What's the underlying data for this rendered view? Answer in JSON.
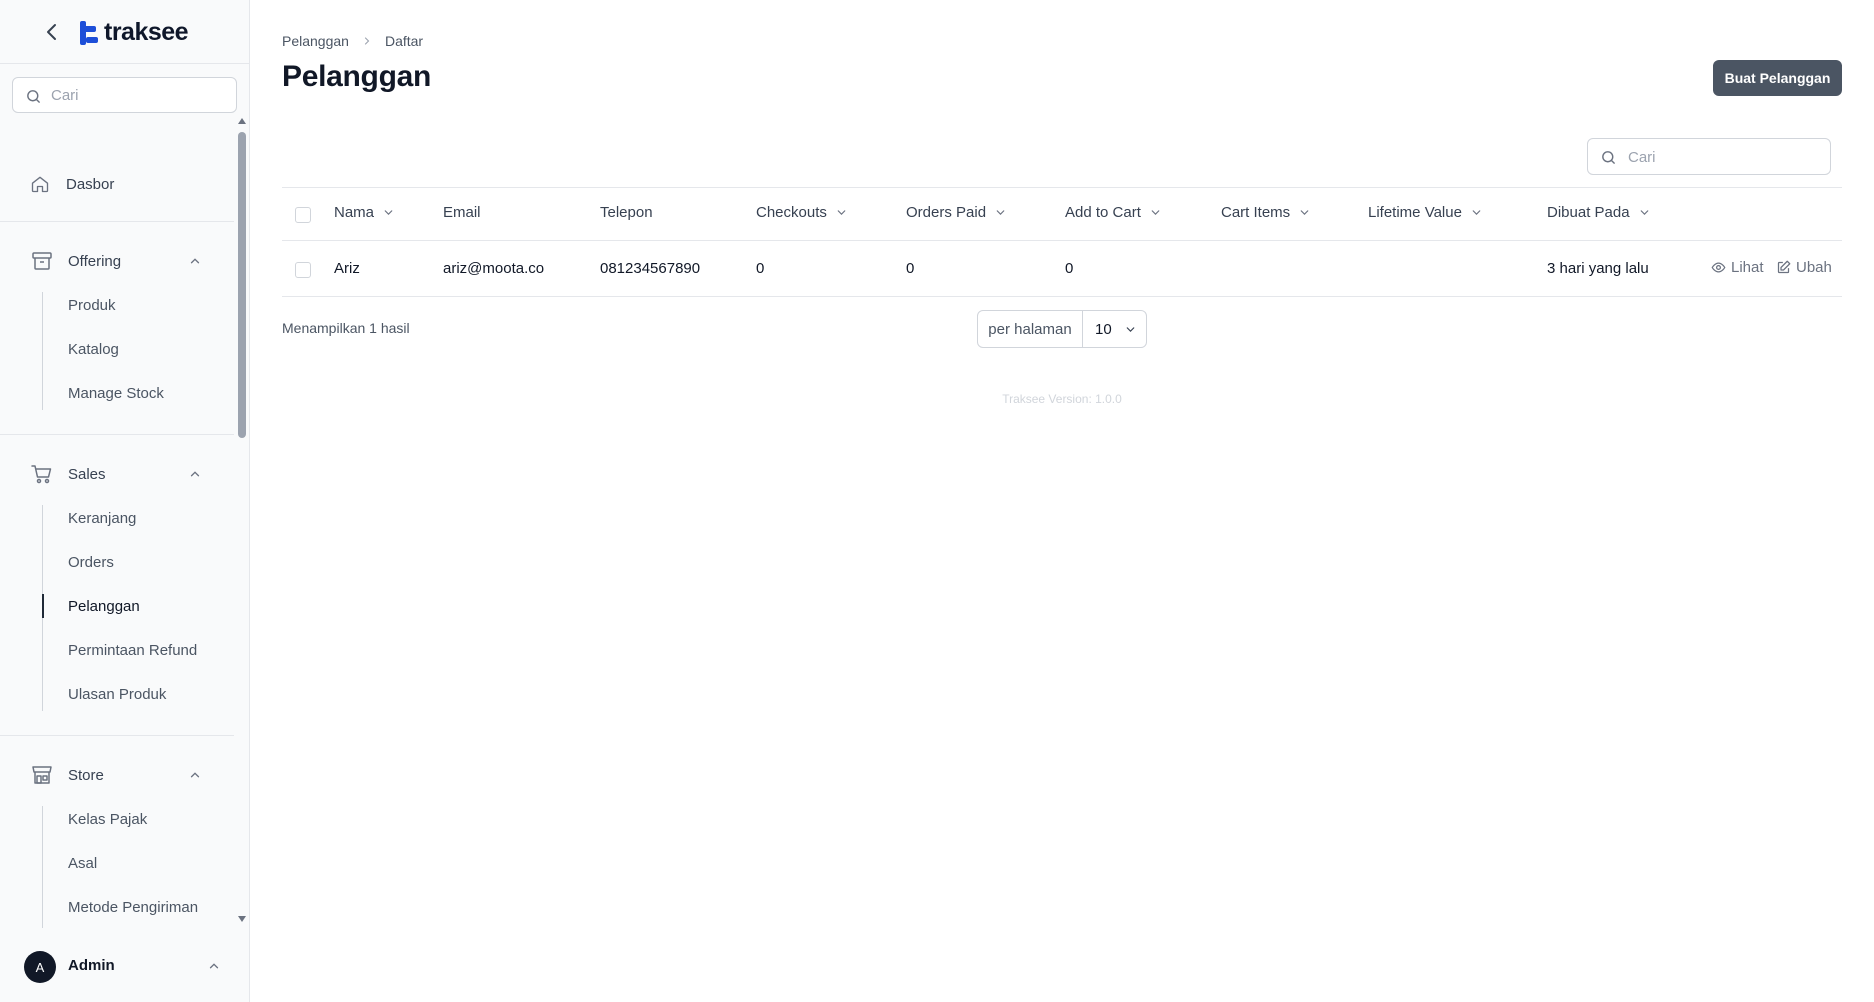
{
  "brand": {
    "name": "traksee",
    "color": "#1d4ed8"
  },
  "sidebar": {
    "search_placeholder": "Cari",
    "dashboard_label": "Dasbor",
    "groups": [
      {
        "label": "Offering",
        "icon": "box-icon",
        "items": [
          "Produk",
          "Katalog",
          "Manage Stock"
        ]
      },
      {
        "label": "Sales",
        "icon": "cart-icon",
        "items": [
          "Keranjang",
          "Orders",
          "Pelanggan",
          "Permintaan Refund",
          "Ulasan Produk"
        ]
      },
      {
        "label": "Store",
        "icon": "store-icon",
        "items": [
          "Kelas Pajak",
          "Asal",
          "Metode Pengiriman"
        ]
      }
    ],
    "active_item": "Pelanggan",
    "user": {
      "initial": "A",
      "name": "Admin"
    }
  },
  "header": {
    "breadcrumb": [
      "Pelanggan",
      "Daftar"
    ],
    "title": "Pelanggan",
    "create_button": "Buat Pelanggan"
  },
  "table": {
    "search_placeholder": "Cari",
    "columns": [
      {
        "label": "Nama",
        "sortable": true
      },
      {
        "label": "Email",
        "sortable": false
      },
      {
        "label": "Telepon",
        "sortable": false
      },
      {
        "label": "Checkouts",
        "sortable": true
      },
      {
        "label": "Orders Paid",
        "sortable": true
      },
      {
        "label": "Add to Cart",
        "sortable": true
      },
      {
        "label": "Cart Items",
        "sortable": true
      },
      {
        "label": "Lifetime Value",
        "sortable": true
      },
      {
        "label": "Dibuat Pada",
        "sortable": true
      }
    ],
    "rows": [
      {
        "nama": "Ariz",
        "email": "ariz@moota.co",
        "telepon": "081234567890",
        "checkouts": "0",
        "orders_paid": "0",
        "add_to_cart": "0",
        "cart_items": "",
        "lifetime_value": "",
        "dibuat_pada": "3 hari yang lalu",
        "view_label": "Lihat",
        "edit_label": "Ubah"
      }
    ],
    "results_text": "Menampilkan 1 hasil",
    "per_page_label": "per halaman",
    "per_page_value": "10"
  },
  "footer": {
    "version": "Traksee Version: 1.0.0"
  }
}
